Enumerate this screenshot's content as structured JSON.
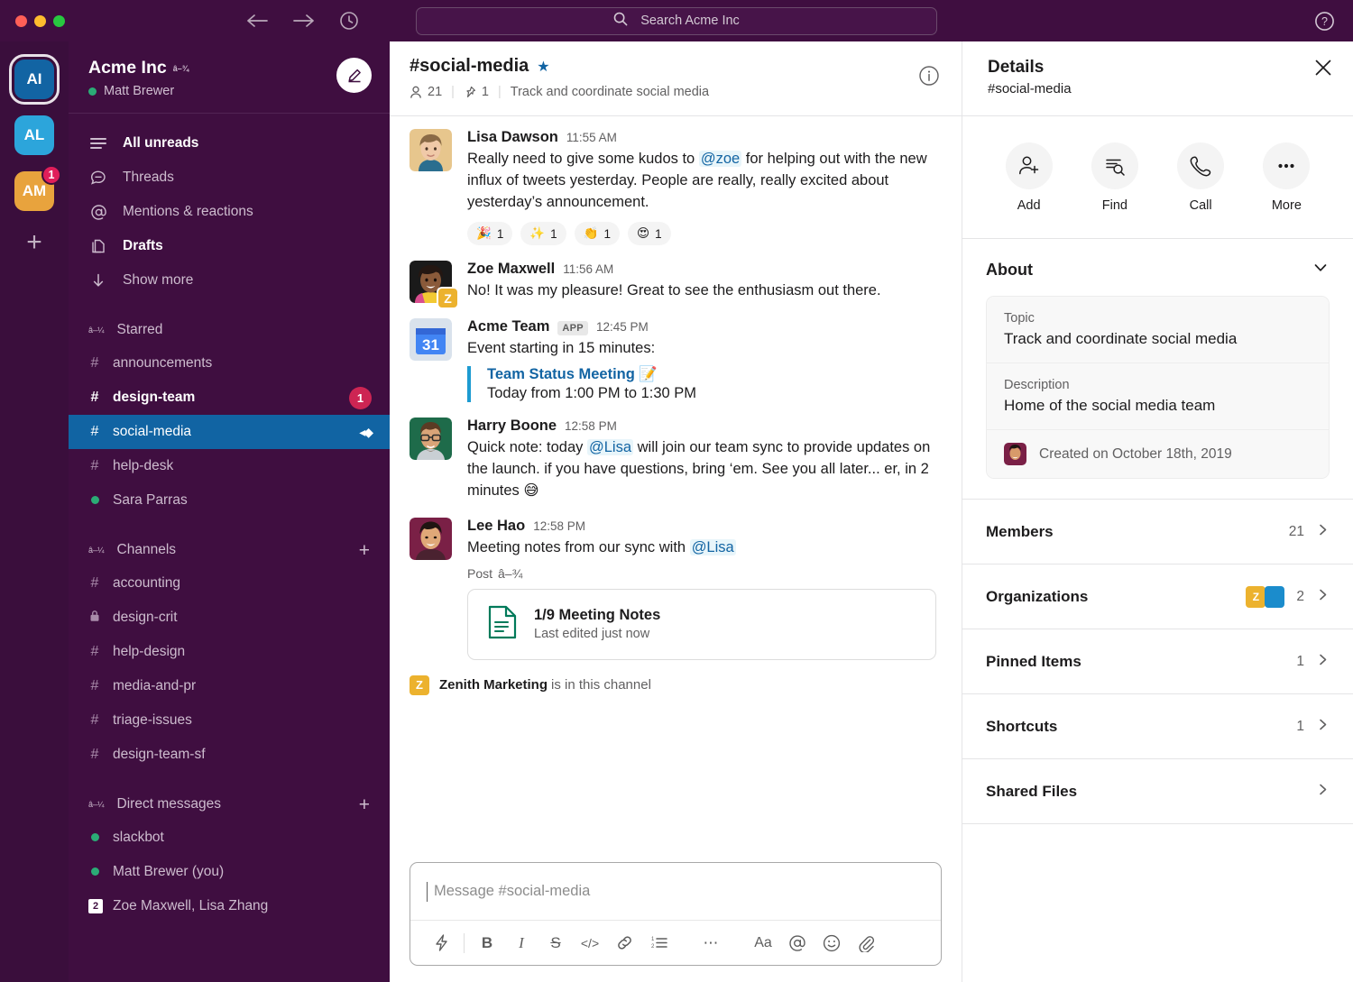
{
  "window": {
    "search_placeholder": "Search Acme Inc",
    "search_icon": "search-icon",
    "back_icon": "arrow-left-icon",
    "forward_icon": "arrow-right-icon",
    "history_icon": "clock-icon",
    "help_icon": "question-circle-icon"
  },
  "rail": {
    "workspaces": [
      {
        "initials": "AI",
        "color": "#1264A3",
        "active": true,
        "badge": ""
      },
      {
        "initials": "AL",
        "color": "#2CA5DB",
        "active": false,
        "badge": ""
      },
      {
        "initials": "AM",
        "color": "#E8A33D",
        "active": false,
        "badge": "1"
      }
    ],
    "add_label": "+"
  },
  "sidebar": {
    "workspace_name": "Acme Inc",
    "user_name": "Matt Brewer",
    "compose_icon": "compose-icon",
    "nav": [
      {
        "label": "All unreads",
        "icon": "unreads-icon",
        "bold": true
      },
      {
        "label": "Threads",
        "icon": "threads-icon",
        "bold": false
      },
      {
        "label": "Mentions & reactions",
        "icon": "at-icon",
        "bold": false
      },
      {
        "label": "Drafts",
        "icon": "drafts-icon",
        "bold": true
      },
      {
        "label": "Show more",
        "icon": "arrow-down-icon",
        "bold": false
      }
    ],
    "sections": [
      {
        "title": "Starred",
        "has_add": false,
        "items": [
          {
            "label": "announcements",
            "kind": "hash",
            "bold": false,
            "badge": "",
            "selected": false,
            "shared": false
          },
          {
            "label": "design-team",
            "kind": "hash",
            "bold": true,
            "badge": "1",
            "selected": false,
            "shared": false
          },
          {
            "label": "social-media",
            "kind": "hash",
            "bold": false,
            "badge": "",
            "selected": true,
            "shared": true
          },
          {
            "label": "help-desk",
            "kind": "hash",
            "bold": false,
            "badge": "",
            "selected": false,
            "shared": false
          },
          {
            "label": "Sara Parras",
            "kind": "presence",
            "bold": false,
            "badge": "",
            "selected": false,
            "shared": false
          }
        ]
      },
      {
        "title": "Channels",
        "has_add": true,
        "items": [
          {
            "label": "accounting",
            "kind": "hash",
            "bold": false,
            "badge": "",
            "selected": false,
            "shared": false
          },
          {
            "label": "design-crit",
            "kind": "lock",
            "bold": false,
            "badge": "",
            "selected": false,
            "shared": false
          },
          {
            "label": "help-design",
            "kind": "hash",
            "bold": false,
            "badge": "",
            "selected": false,
            "shared": false
          },
          {
            "label": "media-and-pr",
            "kind": "hash",
            "bold": false,
            "badge": "",
            "selected": false,
            "shared": false
          },
          {
            "label": "triage-issues",
            "kind": "hash",
            "bold": false,
            "badge": "",
            "selected": false,
            "shared": false
          },
          {
            "label": "design-team-sf",
            "kind": "hash",
            "bold": false,
            "badge": "",
            "selected": false,
            "shared": false
          }
        ]
      },
      {
        "title": "Direct messages",
        "has_add": true,
        "items": [
          {
            "label": "slackbot",
            "kind": "presence",
            "bold": false,
            "badge": "",
            "selected": false,
            "shared": false
          },
          {
            "label": "Matt Brewer (you)",
            "kind": "presence",
            "bold": false,
            "badge": "",
            "selected": false,
            "shared": false
          },
          {
            "label": "Zoe Maxwell, Lisa Zhang",
            "kind": "count",
            "count": "2",
            "bold": false,
            "badge": "",
            "selected": false,
            "shared": false
          }
        ]
      }
    ]
  },
  "channel": {
    "name": "#social-media",
    "starred_icon": "star-icon",
    "member_icon": "person-icon",
    "member_count": "21",
    "pin_icon": "pin-icon",
    "pin_count": "1",
    "topic": "Track and coordinate social media",
    "info_icon": "info-icon"
  },
  "messages": [
    {
      "author": "Lisa Dawson",
      "time": "11:55 AM",
      "is_app": false,
      "app_tag": "",
      "avatar_kind": "lisa",
      "status_badge": "",
      "text_parts": [
        {
          "t": "Really need to give some kudos to ",
          "m": false
        },
        {
          "t": "@zoe",
          "m": true
        },
        {
          "t": " for helping out with the new influx of tweets yesterday. People are really, really excited about yesterday’s announcement.",
          "m": false
        }
      ],
      "reactions": [
        {
          "emoji": "🎉",
          "count": "1",
          "name": "party-popper-reaction"
        },
        {
          "emoji": "✨",
          "count": "1",
          "name": "sparkles-reaction"
        },
        {
          "emoji": "👏",
          "count": "1",
          "name": "clap-reaction"
        },
        {
          "emoji": "😍",
          "count": "1",
          "name": "heart-eyes-reaction"
        }
      ]
    },
    {
      "author": "Zoe Maxwell",
      "time": "11:56 AM",
      "is_app": false,
      "app_tag": "",
      "avatar_kind": "zoe",
      "status_badge": "Z",
      "text_parts": [
        {
          "t": "No! It was my pleasure! Great to see the enthusiasm out there.",
          "m": false
        }
      ],
      "reactions": []
    },
    {
      "author": "Acme Team",
      "time": "12:45 PM",
      "is_app": true,
      "app_tag": "APP",
      "avatar_kind": "calendar",
      "status_badge": "",
      "text_parts": [
        {
          "t": "Event starting in 15 minutes:",
          "m": false
        }
      ],
      "quote": {
        "title": "Team Status Meeting 📝",
        "subtitle": "Today from 1:00 PM to 1:30 PM"
      },
      "reactions": []
    },
    {
      "author": "Harry Boone",
      "time": "12:58 PM",
      "is_app": false,
      "app_tag": "",
      "avatar_kind": "harry",
      "status_badge": "",
      "text_parts": [
        {
          "t": "Quick note: today ",
          "m": false
        },
        {
          "t": "@Lisa",
          "m": true
        },
        {
          "t": " will join our team sync to provide updates on the launch. if you have questions, bring ‘em. See you all later... er, in 2 minutes 😅",
          "m": false
        }
      ],
      "reactions": []
    },
    {
      "author": "Lee Hao",
      "time": "12:58 PM",
      "is_app": false,
      "app_tag": "",
      "avatar_kind": "lee",
      "status_badge": "",
      "text_parts": [
        {
          "t": "Meeting notes from our sync with ",
          "m": false
        },
        {
          "t": "@Lisa",
          "m": true
        }
      ],
      "post_label": "Post",
      "file": {
        "icon": "document-icon",
        "name": "1/9 Meeting Notes",
        "subtitle": "Last edited just now"
      },
      "reactions": []
    }
  ],
  "join_note": {
    "icon_letter": "Z",
    "name": "Zenith Marketing",
    "suffix": " is in this channel"
  },
  "composer": {
    "placeholder": "Message #social-media",
    "toolbar": [
      {
        "glyph": "⚡",
        "name": "shortcuts-icon"
      },
      {
        "glyph": "B",
        "name": "bold-icon"
      },
      {
        "glyph": "I",
        "name": "italic-icon"
      },
      {
        "glyph": "S",
        "name": "strikethrough-icon"
      },
      {
        "glyph": "</>",
        "name": "code-icon"
      },
      {
        "glyph": "🔗",
        "name": "link-icon"
      },
      {
        "glyph": "≣",
        "name": "ordered-list-icon"
      },
      {
        "glyph": "⋯",
        "name": "more-formatting-icon"
      },
      {
        "glyph": "Aa",
        "name": "text-format-icon"
      },
      {
        "glyph": "@",
        "name": "mention-icon"
      },
      {
        "glyph": "☺",
        "name": "emoji-icon"
      },
      {
        "glyph": "📎",
        "name": "attachment-icon"
      }
    ]
  },
  "details": {
    "title": "Details",
    "subtitle": "#social-media",
    "close_icon": "close-icon",
    "actions": [
      {
        "label": "Add",
        "icon": "add-person-icon"
      },
      {
        "label": "Find",
        "icon": "find-icon"
      },
      {
        "label": "Call",
        "icon": "phone-icon"
      },
      {
        "label": "More",
        "icon": "more-icon"
      }
    ],
    "about": {
      "heading": "About",
      "chevron_icon": "chevron-down-icon",
      "topic_label": "Topic",
      "topic_value": "Track and coordinate social media",
      "description_label": "Description",
      "description_value": "Home of the social media team",
      "created_text": "Created on October 18th, 2019"
    },
    "rows": [
      {
        "label": "Members",
        "value": "21",
        "orgs": []
      },
      {
        "label": "Organizations",
        "value": "2",
        "orgs": [
          {
            "letter": "Z",
            "color": "#ECB22E"
          },
          {
            "letter": "",
            "color": "#1B8CCC"
          }
        ]
      },
      {
        "label": "Pinned Items",
        "value": "1",
        "orgs": []
      },
      {
        "label": "Shortcuts",
        "value": "1",
        "orgs": []
      },
      {
        "label": "Shared Files",
        "value": "",
        "orgs": []
      }
    ]
  },
  "colors": {
    "sidebar_bg": "#3F0E40",
    "rail_bg": "#3A0E3C",
    "selected_channel": "#1164A3",
    "badge_red": "#CD2553",
    "link_blue": "#1264A3",
    "presence_green": "#2BAC76",
    "app_yellow": "#ECB22E"
  }
}
